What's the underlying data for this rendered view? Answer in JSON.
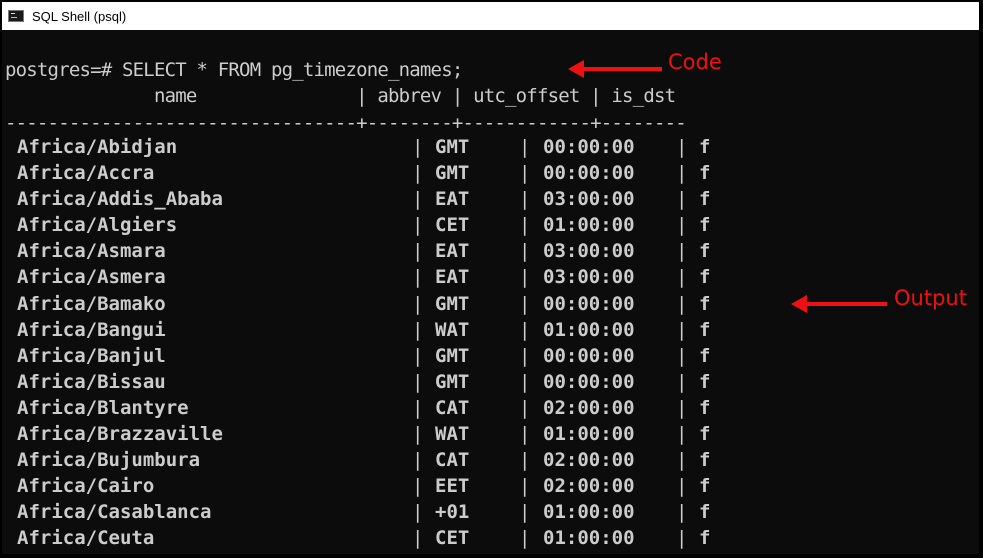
{
  "window": {
    "title": "SQL Shell (psql)",
    "icon": "terminal-icon"
  },
  "terminal": {
    "command": "postgres=# SELECT * FROM pg_timezone_names;",
    "header_line": "              name               | abbrev | utc_offset | is_dst",
    "separator_line": "---------------------------------+--------+------------+--------",
    "columns": [
      "name",
      "abbrev",
      "utc_offset",
      "is_dst"
    ],
    "rows": [
      {
        "name": "Africa/Abidjan",
        "abbrev": "GMT",
        "utc_offset": "00:00:00",
        "is_dst": "f"
      },
      {
        "name": "Africa/Accra",
        "abbrev": "GMT",
        "utc_offset": "00:00:00",
        "is_dst": "f"
      },
      {
        "name": "Africa/Addis_Ababa",
        "abbrev": "EAT",
        "utc_offset": "03:00:00",
        "is_dst": "f"
      },
      {
        "name": "Africa/Algiers",
        "abbrev": "CET",
        "utc_offset": "01:00:00",
        "is_dst": "f"
      },
      {
        "name": "Africa/Asmara",
        "abbrev": "EAT",
        "utc_offset": "03:00:00",
        "is_dst": "f"
      },
      {
        "name": "Africa/Asmera",
        "abbrev": "EAT",
        "utc_offset": "03:00:00",
        "is_dst": "f"
      },
      {
        "name": "Africa/Bamako",
        "abbrev": "GMT",
        "utc_offset": "00:00:00",
        "is_dst": "f"
      },
      {
        "name": "Africa/Bangui",
        "abbrev": "WAT",
        "utc_offset": "01:00:00",
        "is_dst": "f"
      },
      {
        "name": "Africa/Banjul",
        "abbrev": "GMT",
        "utc_offset": "00:00:00",
        "is_dst": "f"
      },
      {
        "name": "Africa/Bissau",
        "abbrev": "GMT",
        "utc_offset": "00:00:00",
        "is_dst": "f"
      },
      {
        "name": "Africa/Blantyre",
        "abbrev": "CAT",
        "utc_offset": "02:00:00",
        "is_dst": "f"
      },
      {
        "name": "Africa/Brazzaville",
        "abbrev": "WAT",
        "utc_offset": "01:00:00",
        "is_dst": "f"
      },
      {
        "name": "Africa/Bujumbura",
        "abbrev": "CAT",
        "utc_offset": "02:00:00",
        "is_dst": "f"
      },
      {
        "name": "Africa/Cairo",
        "abbrev": "EET",
        "utc_offset": "02:00:00",
        "is_dst": "f"
      },
      {
        "name": "Africa/Casablanca",
        "abbrev": "+01",
        "utc_offset": "01:00:00",
        "is_dst": "f"
      },
      {
        "name": "Africa/Ceuta",
        "abbrev": "CET",
        "utc_offset": "01:00:00",
        "is_dst": "f"
      }
    ],
    "column_separator": "|"
  },
  "annotations": {
    "code_label": "Code",
    "output_label": "Output",
    "color": "#ee1111"
  }
}
